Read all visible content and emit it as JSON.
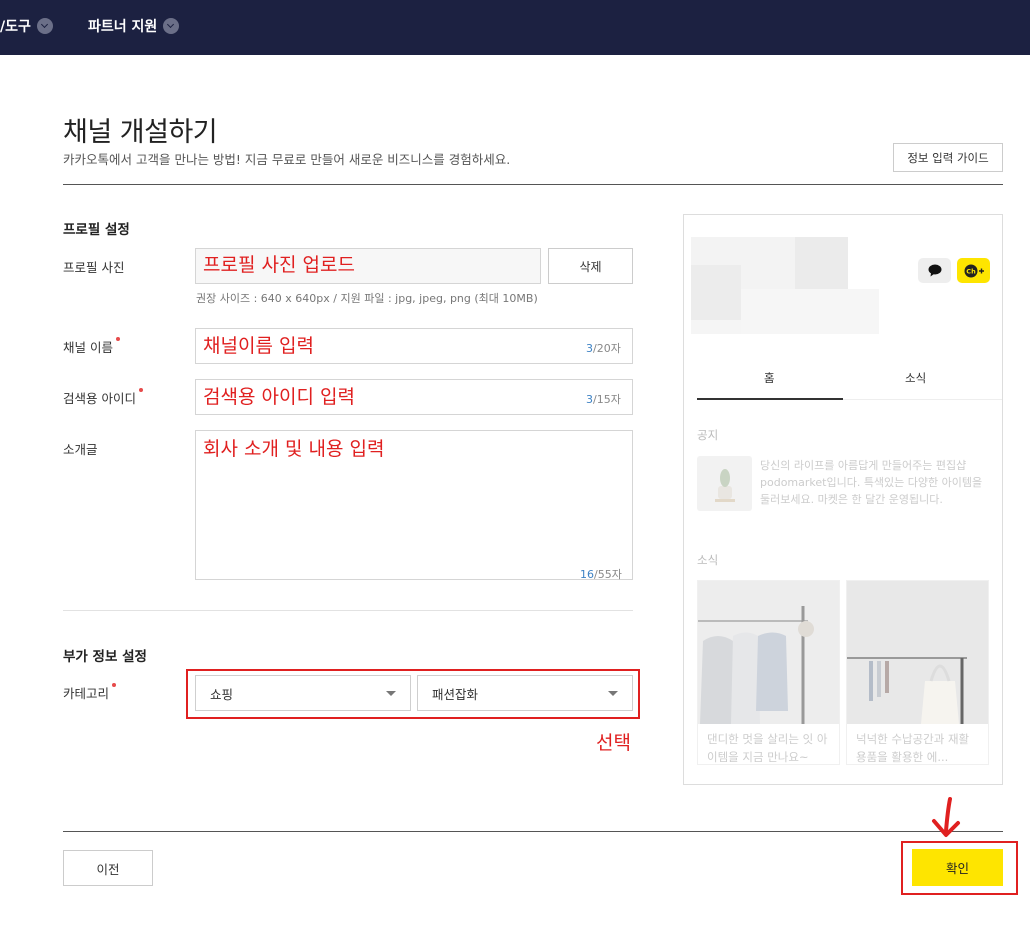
{
  "topnav": {
    "item1": "/도구",
    "item2": "파트너 지원"
  },
  "header": {
    "title": "채널 개설하기",
    "subtitle": "카카오톡에서 고객을 만나는 방법! 지금 무료로 만들어 새로운 비즈니스를 경험하세요.",
    "guide_button": "정보 입력 가이드"
  },
  "profile_section": {
    "title": "프로필 설정",
    "photo": {
      "label": "프로필 사진",
      "annotation": "프로필 사진 업로드",
      "delete_button": "삭제",
      "hint": "권장 사이즈 : 640 x 640px / 지원 파일 : jpg, jpeg, png (최대 10MB)"
    },
    "channel_name": {
      "label": "채널 이름",
      "annotation": "채널이름 입력",
      "count": "3",
      "max": "/20자"
    },
    "search_id": {
      "label": "검색용 아이디",
      "annotation": "검색용 아이디 입력",
      "count": "3",
      "max": "/15자"
    },
    "intro": {
      "label": "소개글",
      "annotation": "회사 소개 및 내용 입력",
      "count": "16",
      "max": "/55자"
    }
  },
  "extra_section": {
    "title": "부가 정보 설정",
    "category": {
      "label": "카테고리",
      "select1": "쇼핑",
      "select2": "패션잡화",
      "annotation": "선택"
    }
  },
  "preview": {
    "tab_home": "홈",
    "tab_news": "소식",
    "notice_label": "공지",
    "notice_text": "당신의 라이프를 아름답게 만들어주는 편집샵 podomarket입니다. 특색있는 다양한 아이템을 둘러보세요. 마켓은 한 달간 운영됩니다.",
    "news_label": "소식",
    "card1_text": "댄디한 멋을 살리는 잇 아이템을 지금 만나요~",
    "card2_text": "넉넉한 수납공간과 재활용품을 활용한 에..."
  },
  "footer": {
    "prev_button": "이전",
    "confirm_button": "확인"
  },
  "colors": {
    "topbar": "#1c2141",
    "confirm": "#fee500",
    "annotation": "#e02020"
  }
}
